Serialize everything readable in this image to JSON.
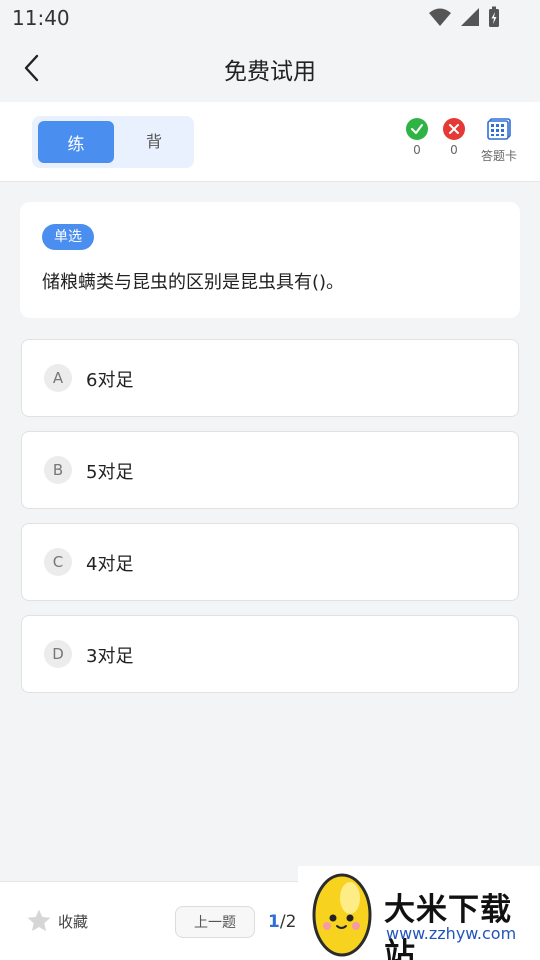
{
  "status_bar": {
    "time": "11:40"
  },
  "nav": {
    "title": "免费试用"
  },
  "mode": {
    "practice_label": "练",
    "memorize_label": "背"
  },
  "stats": {
    "correct_count": "0",
    "wrong_count": "0",
    "answer_sheet_label": "答题卡"
  },
  "question": {
    "type_badge": "单选",
    "text": "储粮螨类与昆虫的区别是昆虫具有()。"
  },
  "options": [
    {
      "letter": "A",
      "text": "6对足"
    },
    {
      "letter": "B",
      "text": "5对足"
    },
    {
      "letter": "C",
      "text": "4对足"
    },
    {
      "letter": "D",
      "text": "3对足"
    }
  ],
  "bottom": {
    "favorite_label": "收藏",
    "prev_label": "上一题",
    "page_current": "1",
    "page_sep_total": "/2"
  },
  "watermark": {
    "title": "大米下载站",
    "url": "www.zzhyw.com"
  },
  "colors": {
    "accent": "#4a8ef0",
    "correct": "#2fb344",
    "wrong": "#e53935"
  }
}
